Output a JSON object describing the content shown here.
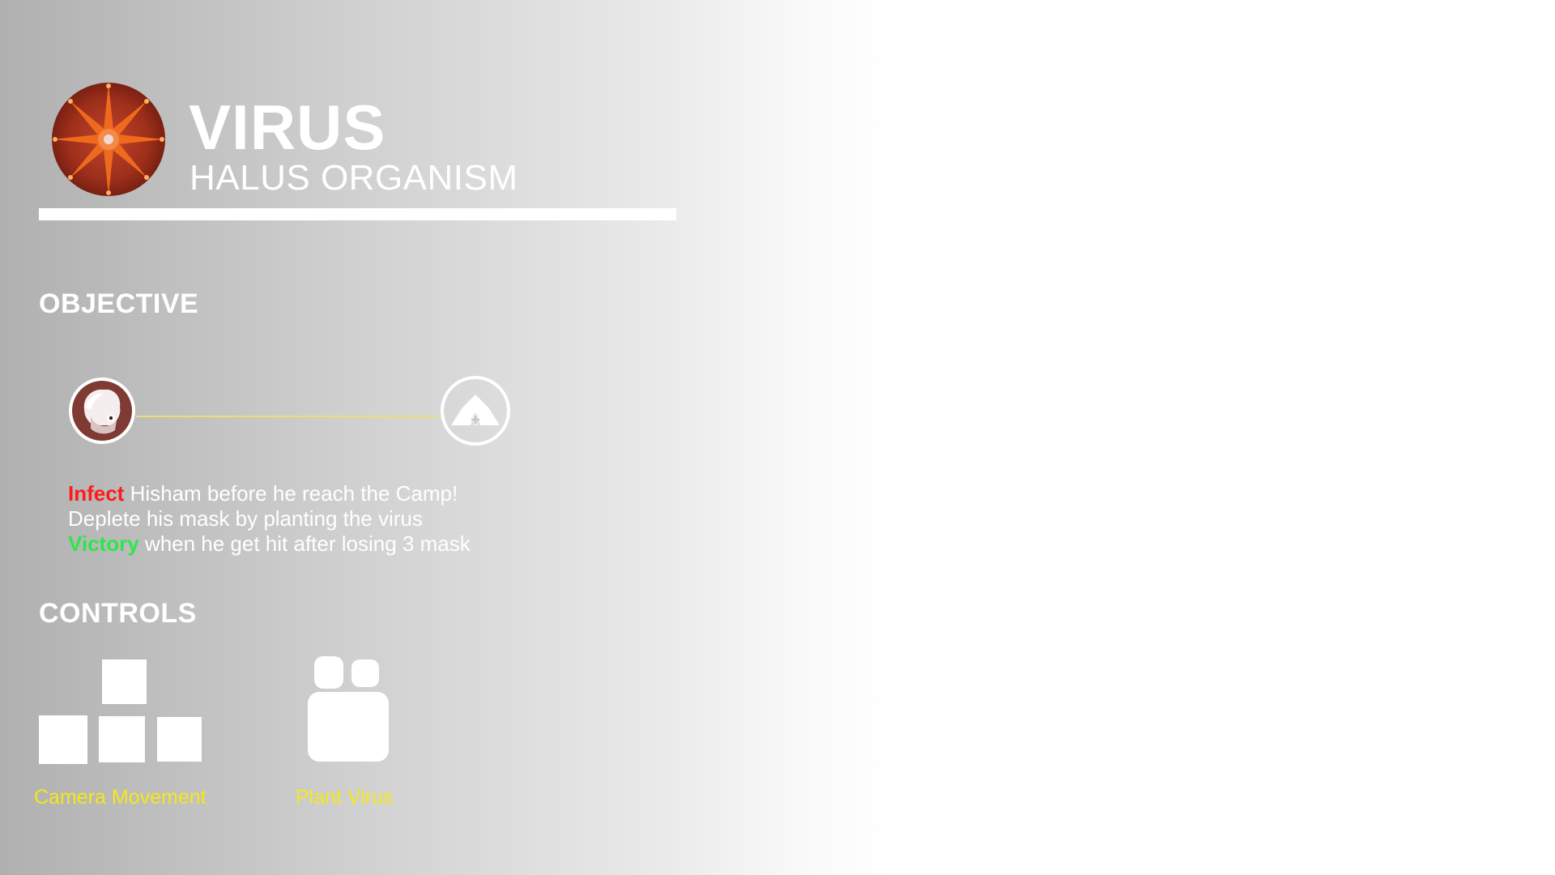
{
  "header": {
    "title": "VIRUS",
    "subtitle": "HALUS ORGANISM",
    "logo_icon": "virus-icon"
  },
  "objective": {
    "heading": "OBJECTIVE",
    "start_icon": "hisham-avatar-icon",
    "end_icon": "camp-tent-icon",
    "path_color": "#e4e07a",
    "lines": [
      {
        "keyword": "Infect",
        "keyword_color": "#ff1a1a",
        "text": " Hisham before he reach the Camp!"
      },
      {
        "keyword": "",
        "text": "Deplete his mask by planting the virus"
      },
      {
        "keyword": "Victory",
        "keyword_color": "#2ee64a",
        "text": " when he get hit after losing 3 mask"
      }
    ]
  },
  "controls": {
    "heading": "CONTROLS",
    "items": [
      {
        "label": "Camera Movement",
        "icon": "wasd-keys-icon"
      },
      {
        "label": "Plant Virus",
        "icon": "mouse-left-click-icon"
      }
    ],
    "label_color": "#f5e81a"
  }
}
